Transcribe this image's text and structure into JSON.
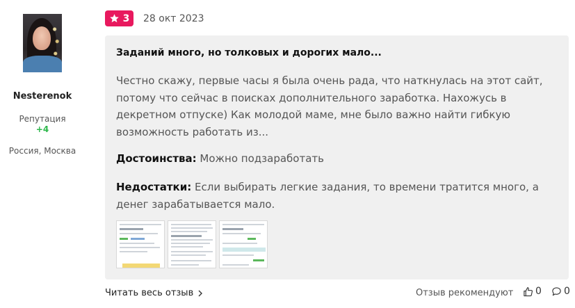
{
  "user": {
    "name": "Nesterenok",
    "reputation_label": "Репутация",
    "reputation_value": "+4",
    "location": "Россия, Москва"
  },
  "review": {
    "rating": "3",
    "date": "28 окт 2023",
    "title": "Заданий много, но толковых и дорогих мало...",
    "body": "Честно скажу, первые часы я была очень рада, что наткнулась на этот сайт, потому что сейчас в поисках дополнительного заработка. Нахожусь в декретном отпуске) Как молодой маме, мне было важно найти гибкую возможность работать из...",
    "pros_label": "Достоинства:",
    "pros_text": "Можно подзаработать",
    "cons_label": "Недостатки:",
    "cons_text": "Если выбирать легкие задания, то времени тратится много, а денег зарабатывается мало."
  },
  "footer": {
    "read_more": "Читать весь отзыв",
    "recommend_label": "Отзыв рекомендуют",
    "likes": "0",
    "comments": "0"
  },
  "colors": {
    "rating_badge": "#e8195e",
    "reputation": "#2db84b",
    "card_bg": "#f0f0f0"
  }
}
